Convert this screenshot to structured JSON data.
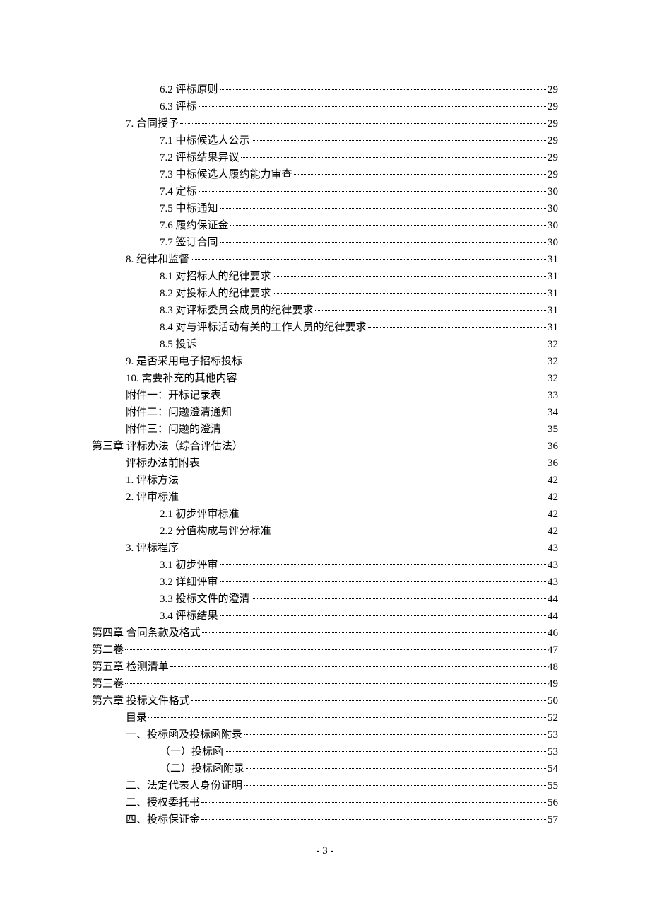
{
  "toc": [
    {
      "indent": 2,
      "label": "6.2 评标原则",
      "page": "29"
    },
    {
      "indent": 2,
      "label": "6.3 评标",
      "page": "29"
    },
    {
      "indent": 1,
      "label": "7.  合同授予",
      "page": "29"
    },
    {
      "indent": 2,
      "label": "7.1 中标候选人公示",
      "page": "29"
    },
    {
      "indent": 2,
      "label": "7.2 评标结果异议",
      "page": "29"
    },
    {
      "indent": 2,
      "label": "7.3 中标候选人履约能力审查",
      "page": "29"
    },
    {
      "indent": 2,
      "label": "7.4 定标",
      "page": "30"
    },
    {
      "indent": 2,
      "label": "7.5 中标通知",
      "page": "30"
    },
    {
      "indent": 2,
      "label": "7.6 履约保证金",
      "page": "30"
    },
    {
      "indent": 2,
      "label": "7.7 签订合同",
      "page": "30"
    },
    {
      "indent": 1,
      "label": "8.  纪律和监督",
      "page": "31"
    },
    {
      "indent": 2,
      "label": "8.1 对招标人的纪律要求",
      "page": "31"
    },
    {
      "indent": 2,
      "label": "8.2 对投标人的纪律要求",
      "page": "31"
    },
    {
      "indent": 2,
      "label": "8.3 对评标委员会成员的纪律要求",
      "page": "31"
    },
    {
      "indent": 2,
      "label": "8.4 对与评标活动有关的工作人员的纪律要求",
      "page": "31"
    },
    {
      "indent": 2,
      "label": "8.5 投诉",
      "page": "32"
    },
    {
      "indent": 1,
      "label": "9.  是否采用电子招标投标",
      "page": "32"
    },
    {
      "indent": 1,
      "label": "10.  需要补充的其他内容",
      "page": "32"
    },
    {
      "indent": 1,
      "label": "附件一：开标记录表",
      "page": "33"
    },
    {
      "indent": 1,
      "label": "附件二：问题澄清通知",
      "page": "34"
    },
    {
      "indent": 1,
      "label": "附件三：问题的澄清",
      "page": "35"
    },
    {
      "indent": 0,
      "label": "第三章 评标办法（综合评估法）",
      "page": "36"
    },
    {
      "indent": 1,
      "label": "评标办法前附表",
      "page": "36"
    },
    {
      "indent": 1,
      "label": "1.  评标方法",
      "page": "42"
    },
    {
      "indent": 1,
      "label": "2.  评审标准",
      "page": "42"
    },
    {
      "indent": 2,
      "label": "2.1 初步评审标准",
      "page": "42"
    },
    {
      "indent": 2,
      "label": "2.2 分值构成与评分标准",
      "page": "42"
    },
    {
      "indent": 1,
      "label": "3.  评标程序",
      "page": "43"
    },
    {
      "indent": 2,
      "label": "3.1 初步评审",
      "page": "43"
    },
    {
      "indent": 2,
      "label": "3.2 详细评审",
      "page": "43"
    },
    {
      "indent": 2,
      "label": "3.3 投标文件的澄清",
      "page": "44"
    },
    {
      "indent": 2,
      "label": "3.4 评标结果",
      "page": "44"
    },
    {
      "indent": 0,
      "label": "第四章 合同条款及格式",
      "page": "46"
    },
    {
      "indent": 0,
      "label": "第二卷",
      "page": "47"
    },
    {
      "indent": 0,
      "label": "第五章 检测清单",
      "page": "48"
    },
    {
      "indent": 0,
      "label": "第三卷",
      "page": "49"
    },
    {
      "indent": 0,
      "label": "第六章 投标文件格式",
      "page": "50"
    },
    {
      "indent": 1,
      "label": "目录",
      "page": "52"
    },
    {
      "indent": 1,
      "label": "一、投标函及投标函附录",
      "page": "53"
    },
    {
      "indent": 2,
      "label": "（一）投标函",
      "page": "53"
    },
    {
      "indent": 2,
      "label": "（二）投标函附录",
      "page": "54"
    },
    {
      "indent": 1,
      "label": "二、法定代表人身份证明",
      "page": "55"
    },
    {
      "indent": 1,
      "label": "二、授权委托书",
      "page": "56"
    },
    {
      "indent": 1,
      "label": "四、投标保证金",
      "page": "57"
    }
  ],
  "footer": "- 3 -"
}
